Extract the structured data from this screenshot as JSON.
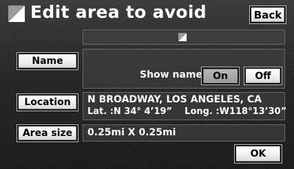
{
  "header": {
    "title": "Edit area to avoid",
    "icon": "edit-area-icon",
    "back_label": "Back"
  },
  "name_row": {
    "button_label": "Name",
    "show_name_label": "Show name",
    "on_label": "On",
    "off_label": "Off",
    "selected": "On"
  },
  "location_row": {
    "button_label": "Location",
    "address": "N BROADWAY, LOS ANGELES, CA",
    "coords": "Lat. :N 34° 4’19”    Long. :W118°13’30”"
  },
  "area_row": {
    "button_label": "Area size",
    "value": "0.25mi X 0.25mi"
  },
  "footer": {
    "ok_label": "OK"
  },
  "colors": {
    "background": "#262626",
    "button_face": "#f0f0f0",
    "selected_button": "#9a9a9a",
    "text": "#ffffff"
  }
}
